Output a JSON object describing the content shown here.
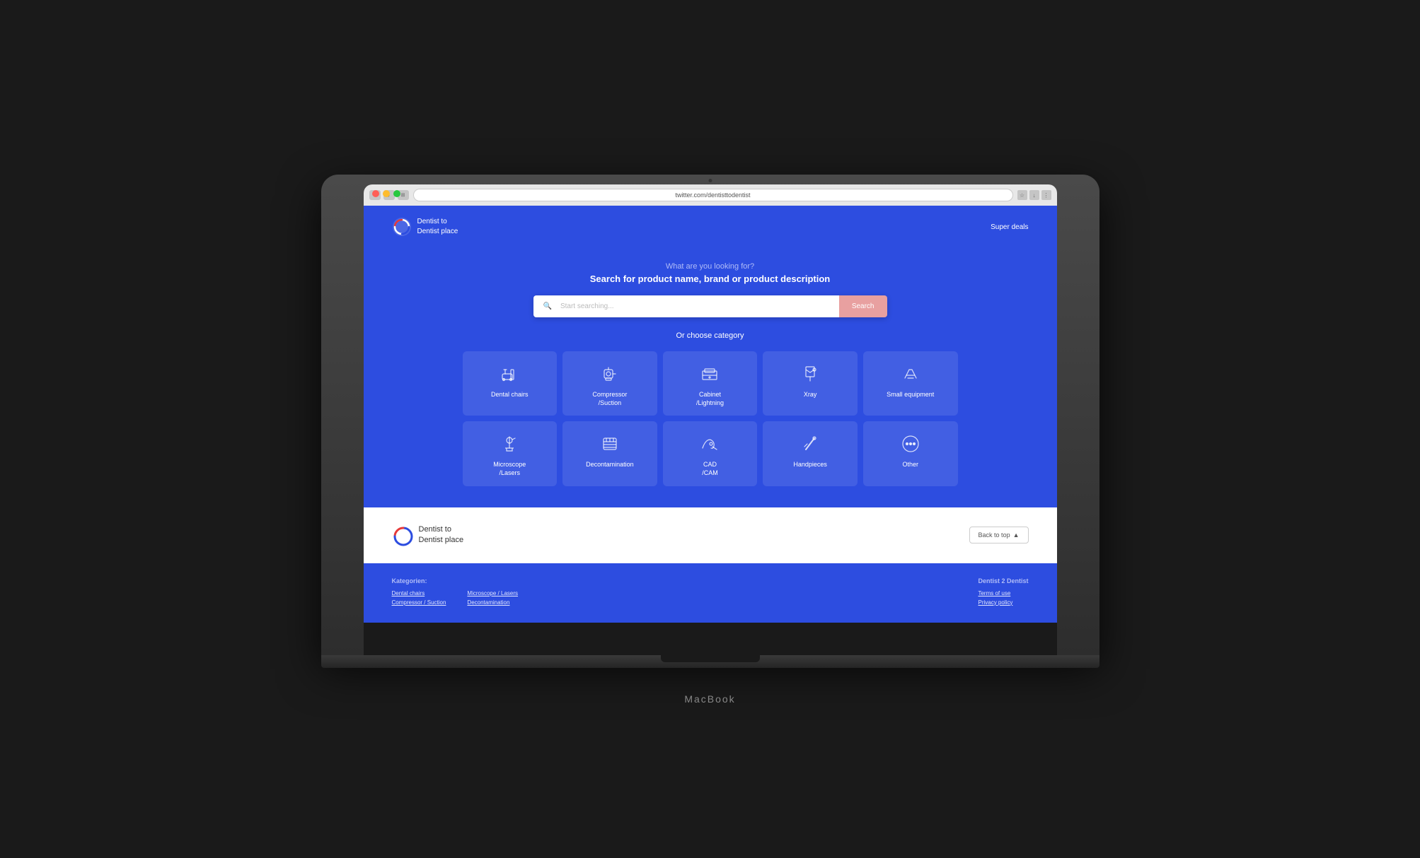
{
  "browser": {
    "url": "twitter.com/dentisttodentist",
    "back_label": "‹",
    "forward_label": "›"
  },
  "header": {
    "logo_text_line1": "Dentist to",
    "logo_text_line2": "Dentist place",
    "nav_link": "Super deals"
  },
  "hero": {
    "subtitle": "What are you looking for?",
    "title": "Search for product name, brand or product description",
    "search_placeholder": "Start searching...",
    "search_button": "Search",
    "category_label": "Or choose category"
  },
  "categories": {
    "row1": [
      {
        "id": "dental-chairs",
        "name": "Dental chairs",
        "icon": "chair"
      },
      {
        "id": "compressor-suction",
        "name": "Compressor\n/Suction",
        "icon": "compressor"
      },
      {
        "id": "cabinet-lightning",
        "name": "Cabinet\n/Lightning",
        "icon": "cabinet"
      },
      {
        "id": "xray",
        "name": "Xray",
        "icon": "xray"
      },
      {
        "id": "small-equipment",
        "name": "Small equipment",
        "icon": "small-eq"
      }
    ],
    "row2": [
      {
        "id": "microscope-lasers",
        "name": "Microscope\n/Lasers",
        "icon": "microscope"
      },
      {
        "id": "decontamination",
        "name": "Decontamination",
        "icon": "decontamination"
      },
      {
        "id": "cad-cam",
        "name": "CAD\n/CAM",
        "icon": "cad"
      },
      {
        "id": "handpieces",
        "name": "Handpieces",
        "icon": "handpieces"
      },
      {
        "id": "other",
        "name": "Other",
        "icon": "other"
      }
    ]
  },
  "footer_top": {
    "logo_text_line1": "Dentist to",
    "logo_text_line2": "Dentist place",
    "back_to_top": "Back to top",
    "back_to_top_arrow": "▲"
  },
  "footer_bottom": {
    "categories_heading": "Kategorien:",
    "categories_links": [
      "Dental chairs",
      "Microscope / Lasers",
      "Compressor / Suction",
      "Decontamination"
    ],
    "company_heading": "Dentist 2 Dentist",
    "company_links": [
      "Terms of use",
      "Privacy policy"
    ]
  },
  "macbook": {
    "label": "MacBook"
  }
}
